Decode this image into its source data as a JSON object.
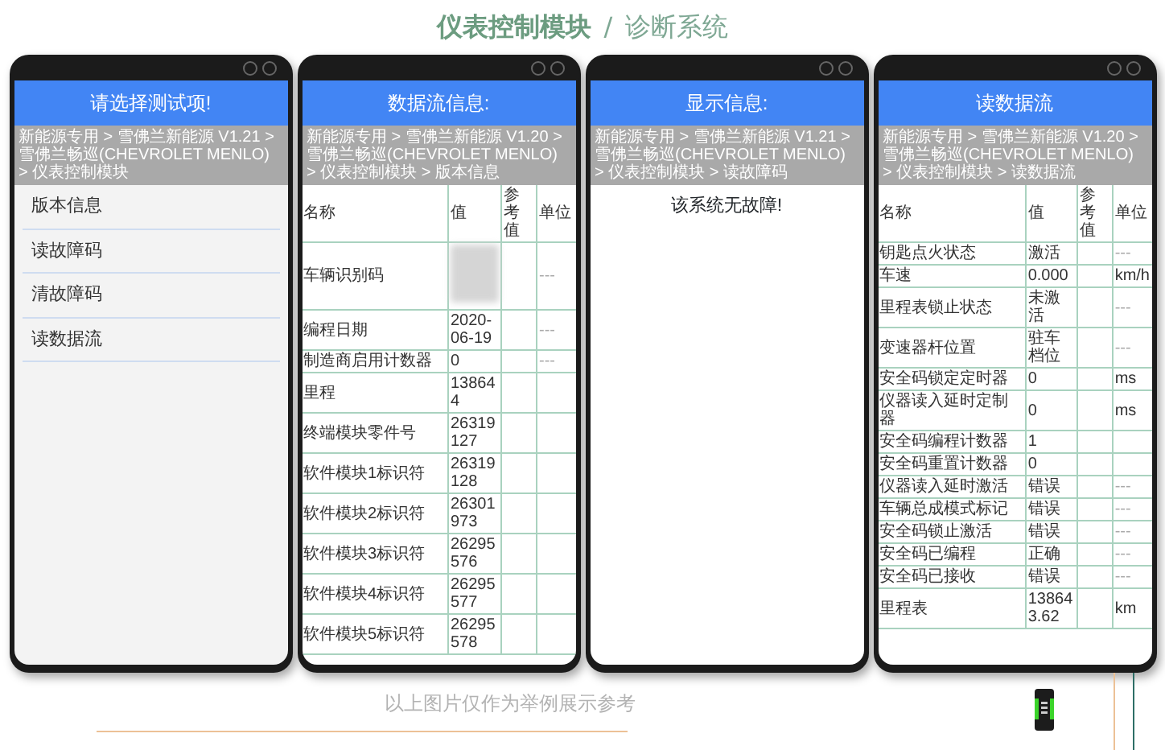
{
  "title": {
    "main": "仪表控制模块",
    "separator": "/",
    "sub": "诊断系统"
  },
  "phones": [
    {
      "kind": "menu",
      "header": "请选择测试项!",
      "breadcrumb": "新能源专用 > 雪佛兰新能源 V1.21 > 雪佛兰畅巡(CHEVROLET MENLO) > 仪表控制模块",
      "items": [
        "版本信息",
        "读故障码",
        "清故障码",
        "读数据流"
      ]
    },
    {
      "kind": "table",
      "header": "数据流信息:",
      "breadcrumb": "新能源专用 > 雪佛兰新能源 V1.20 > 雪佛兰畅巡(CHEVROLET MENLO) > 仪表控制模块 > 版本信息",
      "columns": [
        "名称",
        "值",
        "参考值",
        "单位"
      ],
      "rows": [
        {
          "name": "车辆识别码",
          "value_blurred": true,
          "unit": "---"
        },
        {
          "name": "编程日期",
          "value": "2020-06-19",
          "unit": "---"
        },
        {
          "name": "制造商启用计数器",
          "value": "0",
          "unit": "---"
        },
        {
          "name": "里程",
          "value": "138644"
        },
        {
          "name": "终端模块零件号",
          "value": "26319127"
        },
        {
          "name": "软件模块1标识符",
          "value": "26319128"
        },
        {
          "name": "软件模块2标识符",
          "value": "26301973"
        },
        {
          "name": "软件模块3标识符",
          "value": "26295576"
        },
        {
          "name": "软件模块4标识符",
          "value": "26295577"
        },
        {
          "name": "软件模块5标识符",
          "value": "26295578"
        }
      ]
    },
    {
      "kind": "message",
      "header": "显示信息:",
      "breadcrumb": "新能源专用 > 雪佛兰新能源 V1.21 > 雪佛兰畅巡(CHEVROLET MENLO) > 仪表控制模块 > 读故障码",
      "message": "该系统无故障!"
    },
    {
      "kind": "table",
      "header": "读数据流",
      "breadcrumb": "新能源专用 > 雪佛兰新能源 V1.20 > 雪佛兰畅巡(CHEVROLET MENLO) > 仪表控制模块 > 读数据流",
      "columns": [
        "名称",
        "值",
        "参考值",
        "单位"
      ],
      "rows": [
        {
          "name": "钥匙点火状态",
          "value": "激活",
          "unit": "---"
        },
        {
          "name": "车速",
          "value": "0.000",
          "unit": "km/h"
        },
        {
          "name": "里程表锁止状态",
          "value": "未激活",
          "unit": "---"
        },
        {
          "name": "变速器杆位置",
          "value": "驻车档位",
          "unit": "---"
        },
        {
          "name": "安全码锁定定时器",
          "value": "0",
          "unit": "ms"
        },
        {
          "name": "仪器读入延时定制器",
          "value": "0",
          "unit": "ms"
        },
        {
          "name": "安全码编程计数器",
          "value": "1"
        },
        {
          "name": "安全码重置计数器",
          "value": "0"
        },
        {
          "name": "仪器读入延时激活",
          "value": "错误",
          "unit": "---"
        },
        {
          "name": "车辆总成模式标记",
          "value": "错误",
          "unit": "---"
        },
        {
          "name": "安全码锁止激活",
          "value": "错误",
          "unit": "---"
        },
        {
          "name": "安全码已编程",
          "value": "正确",
          "unit": "---"
        },
        {
          "name": "安全码已接收",
          "value": "错误",
          "unit": "---"
        },
        {
          "name": "里程表",
          "value": "138643.62",
          "unit": "km"
        }
      ]
    }
  ],
  "caption": "以上图片仅作为举例展示参考"
}
